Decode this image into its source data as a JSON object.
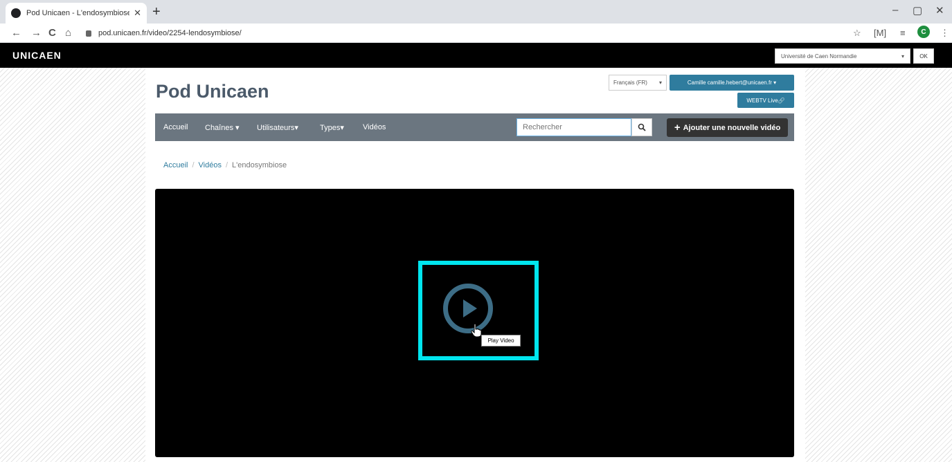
{
  "browser": {
    "tab_title": "Pod Unicaen - L'endosymbiose",
    "tab_close": "✕",
    "new_tab": "+",
    "url": "pod.unicaen.fr/video/2254-lendosymbiose/",
    "profile_initial": "C",
    "icons": {
      "back": "←",
      "forward": "→",
      "reload": "C",
      "home": "⌂",
      "star": "☆",
      "ext": "[M]",
      "reading_list": "≡",
      "menu": "⋮",
      "minimize": "–",
      "restore": "▢",
      "close": "✕"
    }
  },
  "header": {
    "logo": "UNICAEN",
    "university_select": "Université de Caen Normandie",
    "ok_label": "OK"
  },
  "site": {
    "title": "Pod Unicaen",
    "language": "Français (FR)",
    "user_button": "Camille camille.hebert@unicaen.fr ▾",
    "webtv_button": "WEBTV Live🔗"
  },
  "nav": {
    "items": [
      "Accueil",
      "Chaînes ▾",
      "Utilisateurs▾",
      "Types▾",
      "Vidéos"
    ],
    "search_placeholder": "Rechercher",
    "add_video": "Ajouter une nouvelle vidéo",
    "add_plus": "+"
  },
  "breadcrumb": {
    "home": "Accueil",
    "videos": "Vidéos",
    "current": "L'endosymbiose",
    "separator": "/"
  },
  "video": {
    "tooltip": "Play Video"
  },
  "colors": {
    "accent": "#2f7c9e",
    "highlight": "#00e5ee",
    "navbar": "#6b7680"
  }
}
